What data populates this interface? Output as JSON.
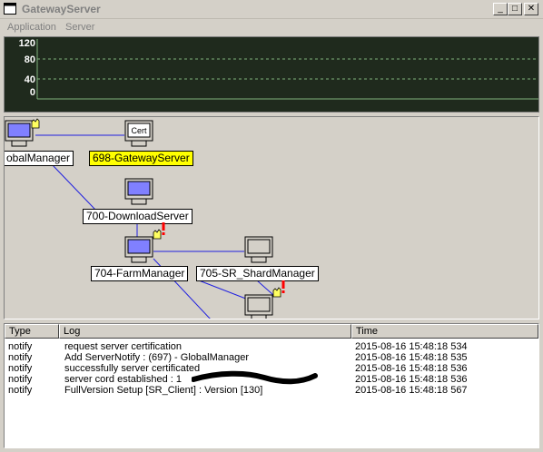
{
  "window": {
    "title": "GatewayServer"
  },
  "menu": {
    "items": [
      "Application",
      "Server"
    ]
  },
  "graph": {
    "y_labels": [
      "120",
      "80",
      "40",
      "0"
    ],
    "background": "#1f2a1d",
    "line_color": "#7fb37a"
  },
  "nodes": {
    "global_manager": {
      "label": "obalManager"
    },
    "gateway": {
      "label": "698-GatewayServer",
      "icon_text": "Cert"
    },
    "download": {
      "label": "700-DownloadServer"
    },
    "farm": {
      "label": "704-FarmManager"
    },
    "shard": {
      "label": "705-SR_ShardManager"
    }
  },
  "log": {
    "columns": [
      "Type",
      "Log",
      "Time"
    ],
    "rows": [
      {
        "type": "notify",
        "log": "request server certification",
        "time": "2015-08-16 15:48:18 534"
      },
      {
        "type": "notify",
        "log": "Add ServerNotify : (697) - GlobalManager",
        "time": "2015-08-16 15:48:18 535"
      },
      {
        "type": "notify",
        "log": "successfully server certificated",
        "time": "2015-08-16 15:48:18 536"
      },
      {
        "type": "notify",
        "log": "server cord established : 1",
        "time": "2015-08-16 15:48:18 536"
      },
      {
        "type": "notify",
        "log": "FullVersion Setup [SR_Client] : Version [130]",
        "time": "2015-08-16 15:48:18 567"
      }
    ]
  },
  "colors": {
    "link": "#2020e0",
    "highlight": "#ffff00",
    "alert": "#ff0000"
  }
}
